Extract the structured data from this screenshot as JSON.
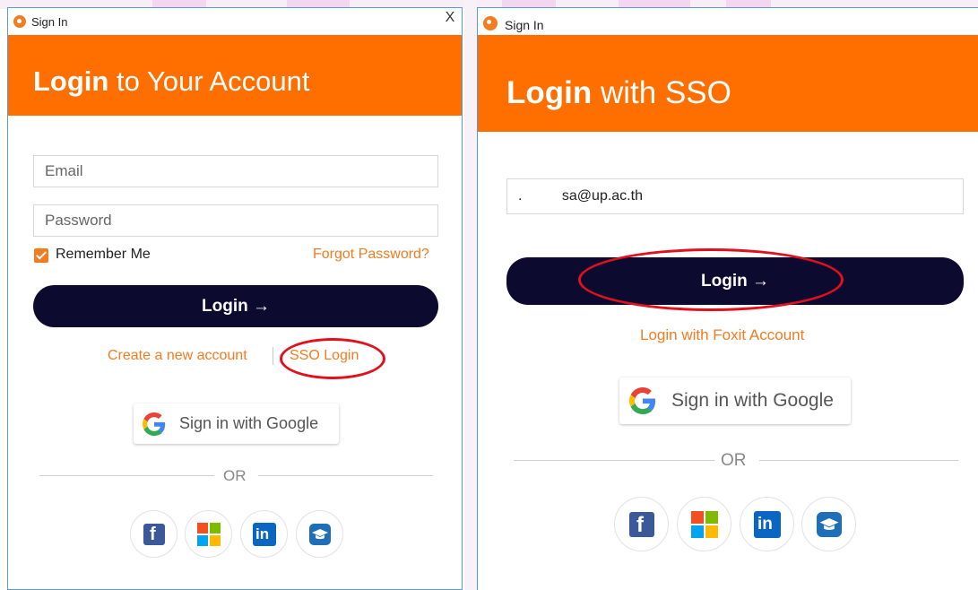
{
  "left_window": {
    "title": "Sign In",
    "close_symbol": "X",
    "header_bold": "Login",
    "header_rest": " to Your Account",
    "email_placeholder": "Email",
    "password_placeholder": "Password",
    "remember_label": "Remember Me",
    "remember_checked": true,
    "forgot_link": "Forgot Password?",
    "login_button": "Login  →",
    "create_account_link": "Create a new account",
    "sso_link": "SSO Login",
    "google_button": "Sign in with Google",
    "or_text": "OR",
    "social_icons": [
      "facebook-icon",
      "microsoft-icon",
      "linkedin-icon",
      "education-icon"
    ]
  },
  "right_window": {
    "title": "Sign In",
    "header_bold": "Login",
    "header_rest": " with SSO",
    "email_value": ".          sa@up.ac.th",
    "login_button": "Login  →",
    "foxit_link": "Login with Foxit Account",
    "google_button": "Sign in with Google",
    "or_text": "OR",
    "social_icons": [
      "facebook-icon",
      "microsoft-icon",
      "linkedin-icon",
      "education-icon"
    ]
  },
  "colors": {
    "brand_orange": "#ff6f00",
    "button_navy": "#0d0a30",
    "link_orange": "#f47b20",
    "highlight_red": "#e2101d"
  }
}
